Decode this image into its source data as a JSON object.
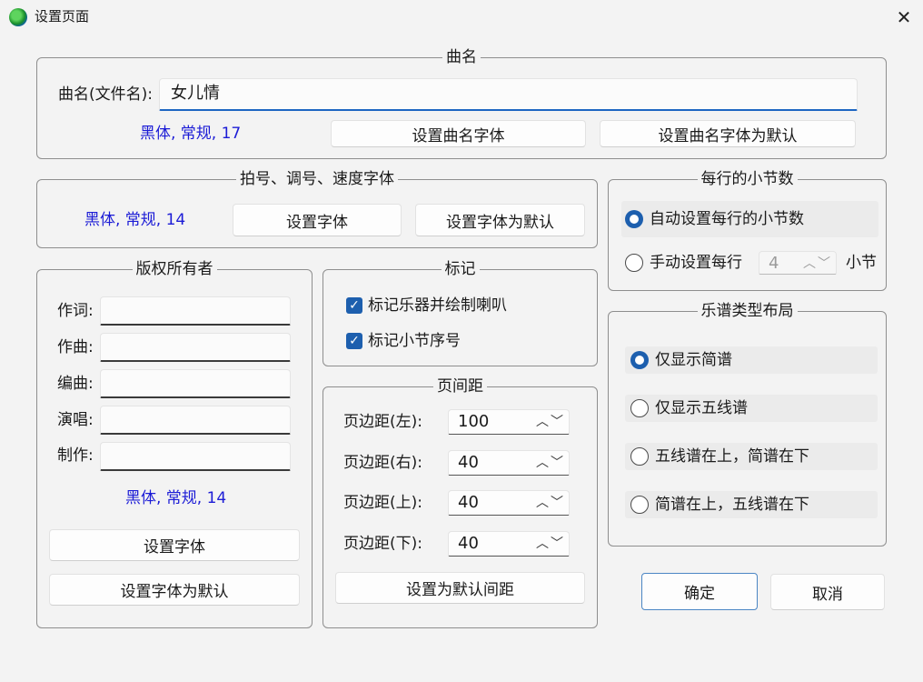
{
  "window": {
    "title": "设置页面"
  },
  "song_name": {
    "group_title": "曲名",
    "label": "曲名(文件名):",
    "value": "女儿情",
    "font_info": "黑体, 常规, 17",
    "set_font_button": "设置曲名字体",
    "set_default_button": "设置曲名字体为默认"
  },
  "beat_key_font": {
    "group_title": "拍号、调号、速度字体",
    "font_info": "黑体, 常规, 14",
    "set_font_button": "设置字体",
    "set_default_button": "设置字体为默认"
  },
  "measures": {
    "group_title": "每行的小节数",
    "auto_label": "自动设置每行的小节数",
    "manual_label": "手动设置每行",
    "manual_value": "4",
    "unit": "小节",
    "selected": "auto"
  },
  "copyright": {
    "group_title": "版权所有者",
    "fields": [
      {
        "label": "作词:",
        "value": ""
      },
      {
        "label": "作曲:",
        "value": ""
      },
      {
        "label": "编曲:",
        "value": ""
      },
      {
        "label": "演唱:",
        "value": ""
      },
      {
        "label": "制作:",
        "value": ""
      }
    ],
    "font_info": "黑体, 常规, 14",
    "set_font_button": "设置字体",
    "set_default_button": "设置字体为默认"
  },
  "marks": {
    "group_title": "标记",
    "items": [
      {
        "label": "标记乐器并绘制喇叭",
        "checked": true
      },
      {
        "label": "标记小节序号",
        "checked": true
      }
    ]
  },
  "margins": {
    "group_title": "页间距",
    "items": [
      {
        "label": "页边距(左):",
        "value": "100"
      },
      {
        "label": "页边距(右):",
        "value": "40"
      },
      {
        "label": "页边距(上):",
        "value": "40"
      },
      {
        "label": "页边距(下):",
        "value": "40"
      }
    ],
    "default_button": "设置为默认间距"
  },
  "layout": {
    "group_title": "乐谱类型布局",
    "options": [
      {
        "label": "仅显示简谱",
        "selected": true
      },
      {
        "label": "仅显示五线谱",
        "selected": false
      },
      {
        "label": "五线谱在上，简谱在下",
        "selected": false
      },
      {
        "label": "简谱在上，五线谱在下",
        "selected": false
      }
    ]
  },
  "actions": {
    "ok": "确定",
    "cancel": "取消"
  },
  "icons": {
    "app": "globe-app-icon",
    "close": "close-icon",
    "spin_arrows": "up-down-arrows"
  },
  "colors": {
    "accent": "#1d5fae",
    "font_info": "#1c1cd6",
    "focus_border": "#4b86c4"
  }
}
